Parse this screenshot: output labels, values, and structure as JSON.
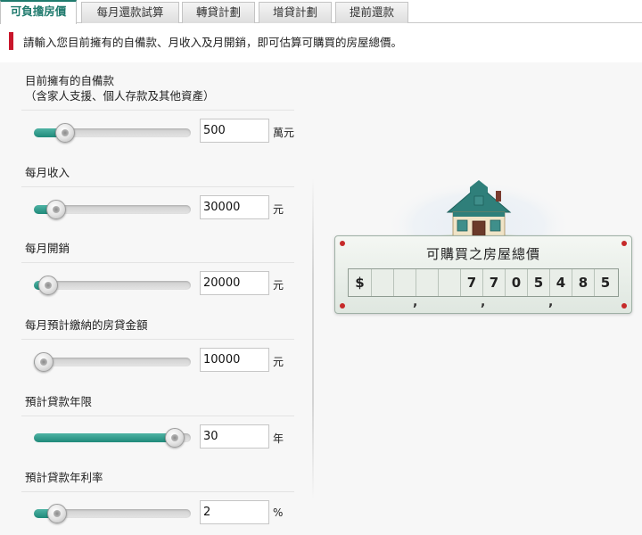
{
  "tabs": [
    {
      "label": "可負擔房價",
      "active": true
    },
    {
      "label": "每月還款試算",
      "active": false
    },
    {
      "label": "轉貸計劃",
      "active": false
    },
    {
      "label": "增貸計劃",
      "active": false
    },
    {
      "label": "提前還款",
      "active": false
    }
  ],
  "instruction": "請輸入您目前擁有的自備款、月收入及月開銷，即可估算可購買的房屋總價。",
  "fields": [
    {
      "label_line1": "目前擁有的自備款",
      "label_line2": "（含家人支援、個人存款及其他資產）",
      "value": "500",
      "unit": "萬元",
      "slider_fraction": 0.2
    },
    {
      "label_line1": "每月收入",
      "value": "30000",
      "unit": "元",
      "slider_fraction": 0.14
    },
    {
      "label_line1": "每月開銷",
      "value": "20000",
      "unit": "元",
      "slider_fraction": 0.09
    },
    {
      "label_line1": "每月預計繳納的房貸金額",
      "value": "10000",
      "unit": "元",
      "slider_fraction": 0.06
    },
    {
      "label_line1": "預計貸款年限",
      "value": "30",
      "unit": "年",
      "slider_fraction": 0.9
    },
    {
      "label_line1": "預計貸款年利率",
      "value": "2",
      "unit": "%",
      "slider_fraction": 0.15
    }
  ],
  "result": {
    "title": "可購買之房屋總價",
    "currency_symbol": "$",
    "digits": [
      "",
      "",
      "",
      "",
      "7",
      "7",
      "0",
      "5",
      "4",
      "8",
      "5"
    ]
  },
  "colors": {
    "accent": "#1f7a6d",
    "slider_fill": "#2a9484",
    "instruction_bar": "#c9162b",
    "rivet": "#c62a2a"
  },
  "icons": {
    "house": "house-illustration",
    "slider_knob": "slider-knob-icon"
  }
}
